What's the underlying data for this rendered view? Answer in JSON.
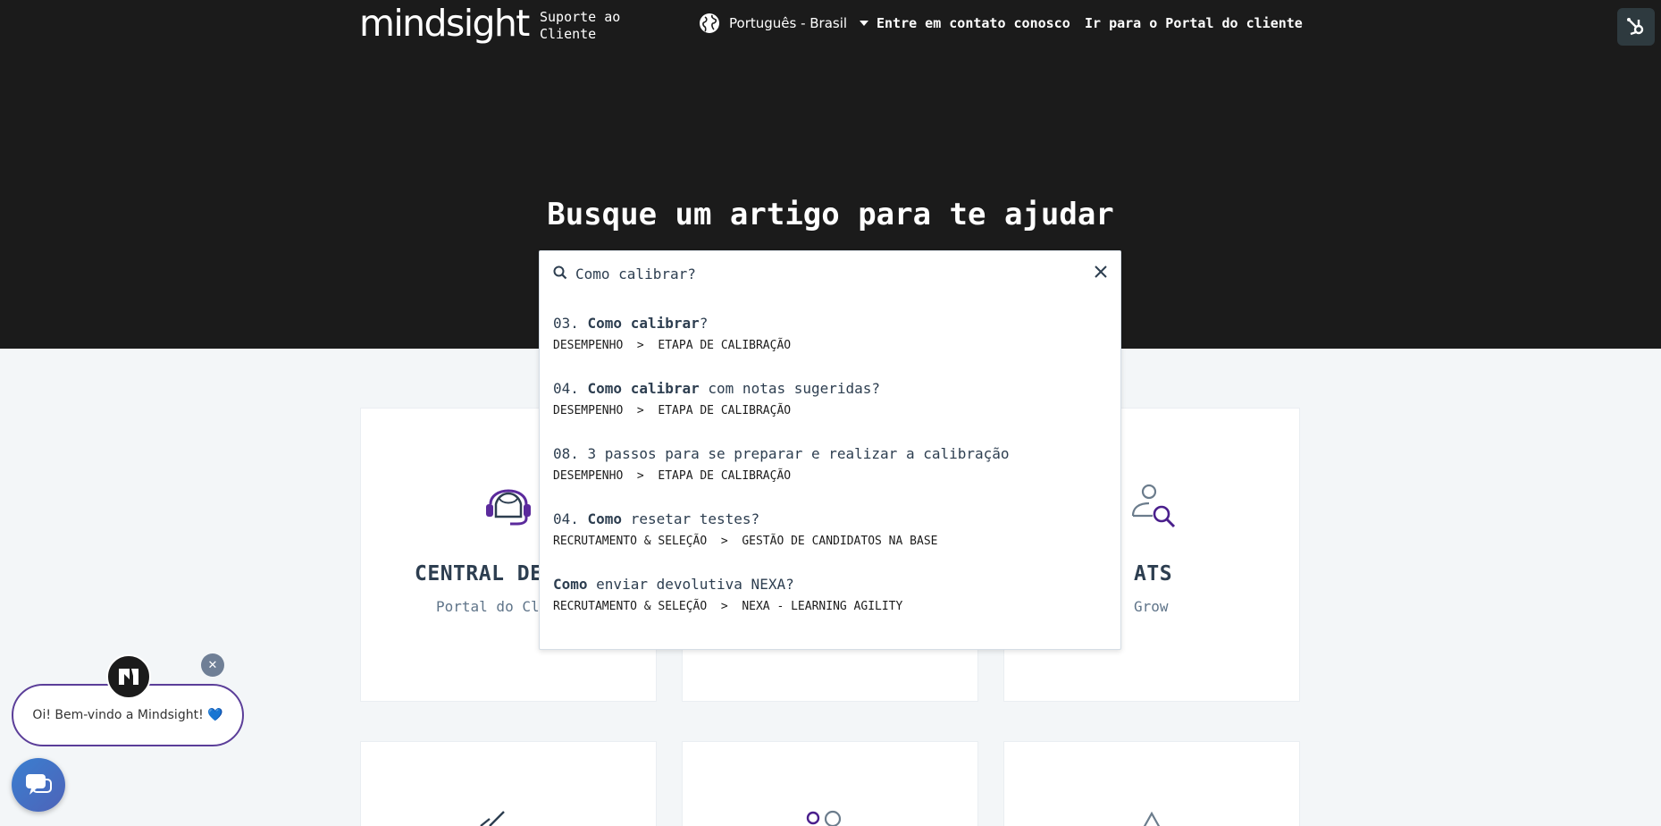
{
  "header": {
    "logo": "mindsight",
    "subtitle": "Suporte ao Cliente",
    "language": "Português - Brasil",
    "nav": [
      "Entre em contato conosco",
      "Ir para o Portal do cliente"
    ],
    "hs_button_icon": "hubspot-icon"
  },
  "hero": {
    "title": "Busque um artigo para te ajudar"
  },
  "search": {
    "value": "Como calibrar?",
    "results": [
      {
        "prefix": "03. ",
        "bold": "Como calibrar",
        "suffix": "?",
        "path": "DESEMPENHO  >  ETAPA DE CALIBRAÇÃO"
      },
      {
        "prefix": "04. ",
        "bold": "Como calibrar",
        "suffix": " com notas sugeridas?",
        "path": "DESEMPENHO  >  ETAPA DE CALIBRAÇÃO"
      },
      {
        "prefix": "08. 3 passos para se preparar e realizar a calibração",
        "bold": "",
        "suffix": "",
        "path": "DESEMPENHO  >  ETAPA DE CALIBRAÇÃO"
      },
      {
        "prefix": "04. ",
        "bold": "Como",
        "suffix": " resetar testes?",
        "path": "RECRUTAMENTO & SELEÇÃO  >  GESTÃO DE CANDIDATOS NA BASE"
      },
      {
        "prefix": "",
        "bold": "Como",
        "suffix": " enviar devolutiva NEXA?",
        "path": "RECRUTAMENTO & SELEÇÃO  >  NEXA - LEARNING AGILITY"
      }
    ]
  },
  "cards": [
    {
      "title": "CENTRAL DE",
      "subtitle": "Portal do Cl",
      "icon": "headset-icon"
    },
    {
      "title": "ATS",
      "subtitle": "Grow",
      "icon": "user-search-icon"
    }
  ],
  "chat": {
    "greeting": "Oi! Bem-vindo a Mindsight! 💙",
    "close": "✕"
  },
  "colors": {
    "brand_purple": "#5b3e99",
    "dark": "#1b1b1b"
  }
}
